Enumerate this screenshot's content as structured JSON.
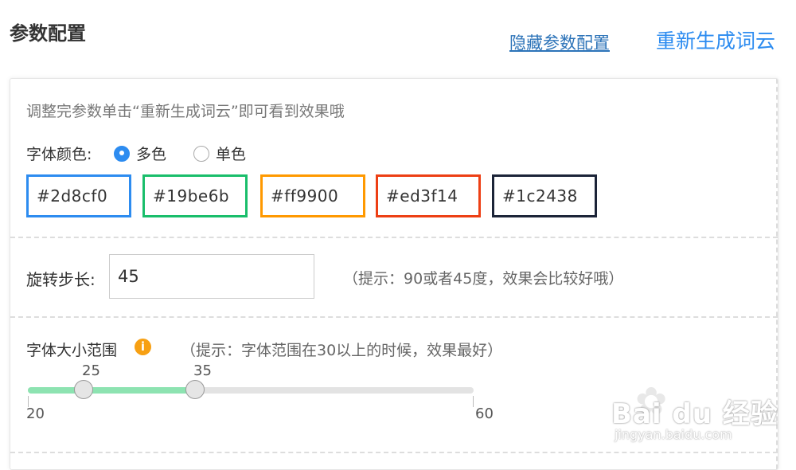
{
  "header": {
    "title": "参数配置",
    "hide_link": "隐藏参数配置",
    "regen_link": "重新生成词云"
  },
  "panel": {
    "hint": "调整完参数单击“重新生成词云”即可看到效果哦",
    "font_color": {
      "label": "字体颜色:",
      "options": [
        {
          "label": "多色",
          "selected": true
        },
        {
          "label": "单色",
          "selected": false
        }
      ],
      "swatches": [
        "#2d8cf0",
        "#19be6b",
        "#ff9900",
        "#ed3f14",
        "#1c2438"
      ]
    },
    "rotation": {
      "label": "旋转步长:",
      "value": "45",
      "tip": "（提示：90或者45度，效果会比较好哦）"
    },
    "font_size": {
      "label": "字体大小范围",
      "info_icon": "info-icon",
      "tip": "（提示：字体范围在30以上的时候，效果最好）",
      "low": "25",
      "high": "35",
      "min": "20",
      "max": "60"
    }
  },
  "colors": {
    "accent": "#2d8cf0",
    "link": "#2c73b8",
    "slider_fill": "#8de3b1",
    "info": "#f7a013"
  },
  "watermark": {
    "brand": "Bai du 经验",
    "url": "jingyan.baidu.com"
  }
}
